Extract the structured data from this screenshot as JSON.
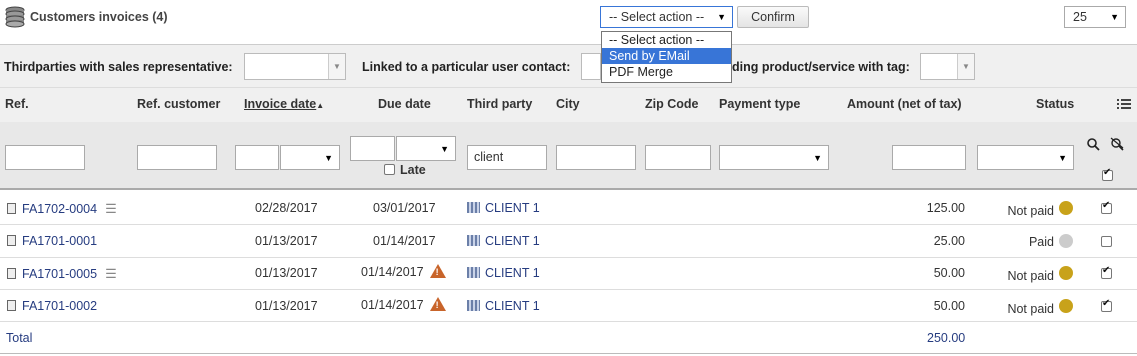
{
  "page": {
    "title": "Customers invoices (4)",
    "coins_icon": "coins-stack-icon"
  },
  "massaction": {
    "selected": "-- Select action --",
    "options": [
      "-- Select action --",
      "Send by EMail",
      "PDF Merge"
    ],
    "highlighted": "Send by EMail",
    "confirm_label": "Confirm"
  },
  "pagination": {
    "limit": "25"
  },
  "filters": {
    "sales_rep_label": "Thirdparties with sales representative:",
    "user_contact_label": "Linked to a particular user contact:",
    "tag_label": "ding product/service with tag:"
  },
  "columns": {
    "ref": "Ref.",
    "ref_customer": "Ref. customer",
    "invoice_date": "Invoice date",
    "due_date": "Due date",
    "third_party": "Third party",
    "city": "City",
    "zip": "Zip Code",
    "payment_type": "Payment type",
    "amount": "Amount (net of tax)",
    "status": "Status"
  },
  "search": {
    "third_party_value": "client",
    "late_label": "Late"
  },
  "rows": [
    {
      "ref": "FA1702-0004",
      "has_notes": true,
      "invoice_date": "02/28/2017",
      "due_date": "03/01/2017",
      "late": false,
      "third_party": "CLIENT 1",
      "amount": "125.00",
      "status": "Not paid",
      "status_color": "#c8a21a",
      "checked": true
    },
    {
      "ref": "FA1701-0001",
      "has_notes": false,
      "invoice_date": "01/13/2017",
      "due_date": "01/14/2017",
      "late": false,
      "third_party": "CLIENT 1",
      "amount": "25.00",
      "status": "Paid",
      "status_color": "#cccccc",
      "checked": false
    },
    {
      "ref": "FA1701-0005",
      "has_notes": true,
      "invoice_date": "01/13/2017",
      "due_date": "01/14/2017",
      "late": true,
      "third_party": "CLIENT 1",
      "amount": "50.00",
      "status": "Not paid",
      "status_color": "#c8a21a",
      "checked": true
    },
    {
      "ref": "FA1701-0002",
      "has_notes": false,
      "invoice_date": "01/13/2017",
      "due_date": "01/14/2017",
      "late": true,
      "third_party": "CLIENT 1",
      "amount": "50.00",
      "status": "Not paid",
      "status_color": "#c8a21a",
      "checked": true
    }
  ],
  "total": {
    "label": "Total",
    "amount": "250.00"
  }
}
